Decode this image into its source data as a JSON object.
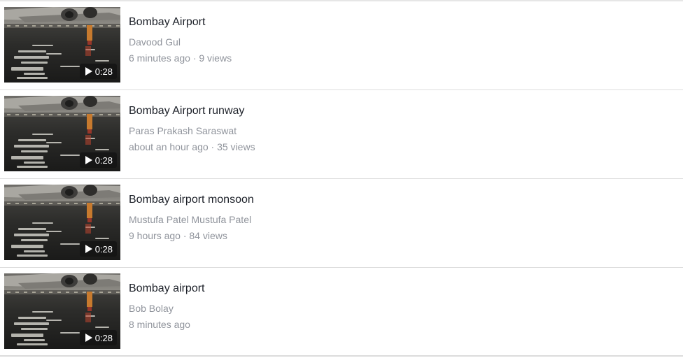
{
  "colors": {
    "title": "#1d2129",
    "secondary": "#90949c",
    "divider": "#dcdcdc",
    "duration_badge": "#141414"
  },
  "videos": [
    {
      "title": "Bombay Airport",
      "author": "Davood Gul",
      "stats": "6 minutes ago · 9 views",
      "duration": "0:28",
      "thumbnail_icon": "play-icon"
    },
    {
      "title": "Bombay Airport runway",
      "author": "Paras Prakash Saraswat",
      "stats": "about an hour ago · 35 views",
      "duration": "0:28",
      "thumbnail_icon": "play-icon"
    },
    {
      "title": "Bombay airport monsoon",
      "author": "Mustufa Patel Mustufa Patel",
      "stats": "9 hours ago · 84 views",
      "duration": "0:28",
      "thumbnail_icon": "play-icon"
    },
    {
      "title": "Bombay airport",
      "author": "Bob Bolay",
      "stats": "8 minutes ago",
      "duration": "0:28",
      "thumbnail_icon": "play-icon"
    }
  ]
}
